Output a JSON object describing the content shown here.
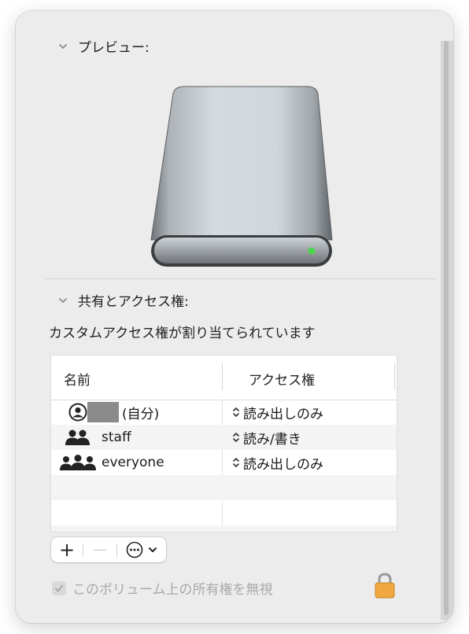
{
  "preview": {
    "header": "プレビュー:"
  },
  "sharing": {
    "header": "共有とアクセス権:",
    "status": "カスタムアクセス権が割り当てられています",
    "columns": {
      "name": "名前",
      "access": "アクセス権"
    },
    "rows": [
      {
        "name": "(自分)",
        "access": "読み出しのみ",
        "icon": "user-circle-icon"
      },
      {
        "name": "staff",
        "access": "読み/書き",
        "icon": "two-users-icon"
      },
      {
        "name": "everyone",
        "access": "読み出しのみ",
        "icon": "group-users-icon"
      }
    ],
    "toolbar": {
      "add": "+",
      "remove": "—"
    },
    "ignore_ownership": {
      "label": "このボリューム上の所有権を無視",
      "checked": true,
      "enabled": false
    }
  }
}
